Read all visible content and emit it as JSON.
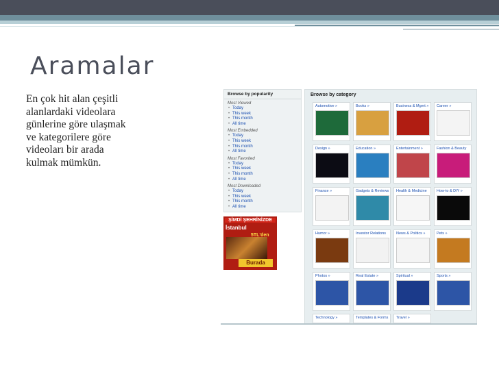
{
  "slide": {
    "title": "Aramalar",
    "body_lines": [
      "En çok hit alan çeşitli",
      "alanlardaki videolara",
      "günlerine göre ulaşmak",
      "ve kategorilere göre",
      "videoları bir arada",
      "kulmak mümkün."
    ]
  },
  "popularity": {
    "title": "Browse by popularity",
    "groups": [
      {
        "name": "Most Viewed",
        "links": [
          "Today",
          "This week",
          "This month",
          "All time"
        ]
      },
      {
        "name": "Most Embedded",
        "links": [
          "Today",
          "This week",
          "This month",
          "All time"
        ]
      },
      {
        "name": "Most Favorited",
        "links": [
          "Today",
          "This week",
          "This month",
          "All time"
        ]
      },
      {
        "name": "Most Downloaded",
        "links": [
          "Today",
          "This week",
          "This month",
          "All time"
        ]
      }
    ]
  },
  "ad": {
    "line1": "ŞİMDİ ŞEHRİNİZDE",
    "line2": "İstanbul",
    "line3": "5TL'den",
    "line4": "Burada"
  },
  "categories": {
    "title": "Browse by category",
    "items": [
      {
        "label": "Automotive »",
        "color": "#1e6a3a"
      },
      {
        "label": "Books »",
        "color": "#d8a040"
      },
      {
        "label": "Business & Mgmt »",
        "color": "#b01d12"
      },
      {
        "label": "Career »",
        "color": "#f4f4f4"
      },
      {
        "label": "Design »",
        "color": "#0c0c14"
      },
      {
        "label": "Education »",
        "color": "#2a7fc0"
      },
      {
        "label": "Entertainment »",
        "color": "#c0454a"
      },
      {
        "label": "Fashion & Beauty",
        "color": "#c81c7a"
      },
      {
        "label": "Finance »",
        "color": "#f3f3f3"
      },
      {
        "label": "Gadgets & Reviews",
        "color": "#2f8aa8"
      },
      {
        "label": "Health & Medicine",
        "color": "#f6f6f6"
      },
      {
        "label": "How-to & DIY »",
        "color": "#0a0a0a"
      },
      {
        "label": "Humor »",
        "color": "#7a3a10"
      },
      {
        "label": "Investor Relations",
        "color": "#f2f2f2"
      },
      {
        "label": "News & Politics »",
        "color": "#f4f4f4"
      },
      {
        "label": "Pets »",
        "color": "#c47a20"
      },
      {
        "label": "Photos »",
        "color": "#2d55a6"
      },
      {
        "label": "Real Estate »",
        "color": "#2d55a6"
      },
      {
        "label": "Spiritual »",
        "color": "#1b3a8a"
      },
      {
        "label": "Sports »",
        "color": "#2d55a6"
      },
      {
        "label": "Technology »",
        "color": "#ffffff"
      },
      {
        "label": "Templates & Forms",
        "color": "#ffffff"
      },
      {
        "label": "Travel »",
        "color": "#ffffff"
      }
    ],
    "sub_labels": {
      "real_estate": "Real Estate",
      "sports": "Sports"
    }
  }
}
